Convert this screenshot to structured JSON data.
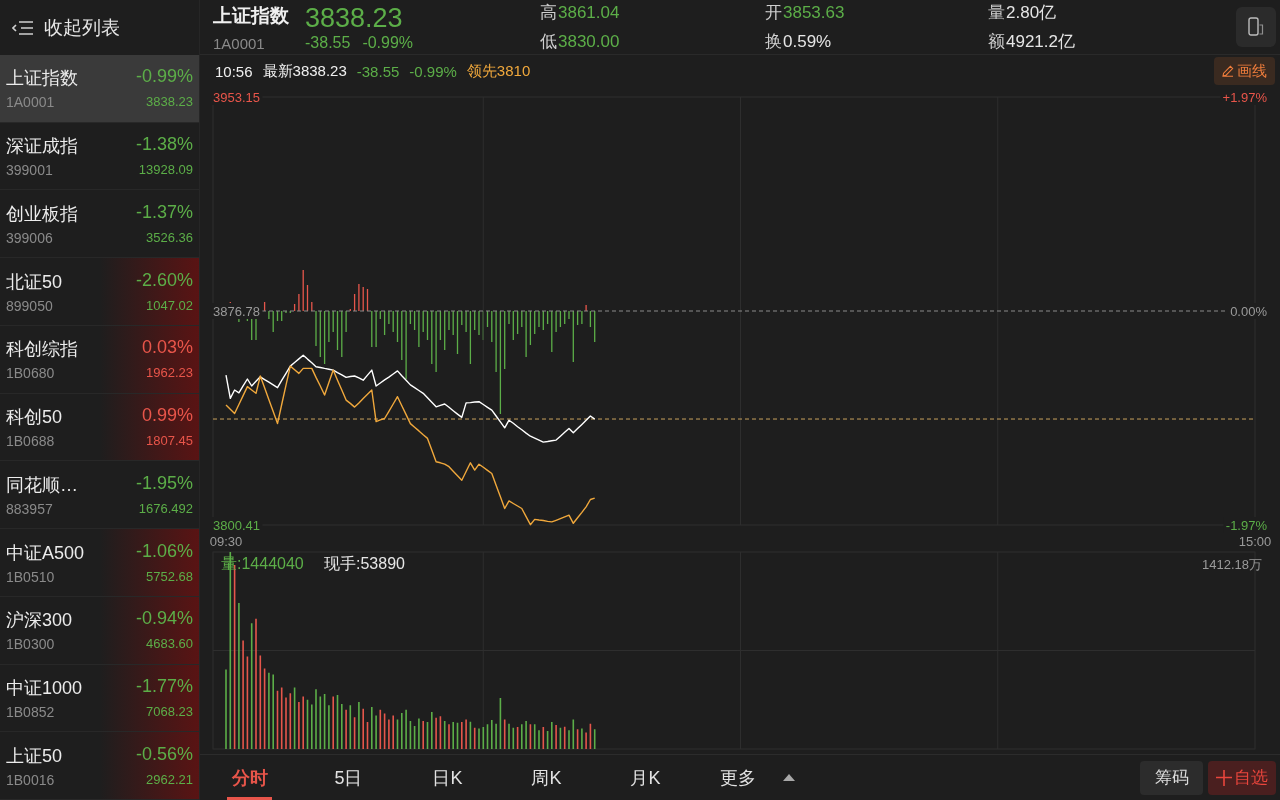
{
  "sidebar": {
    "header": {
      "label": "收起列表"
    },
    "items": [
      {
        "name": "上证指数",
        "code": "1A0001",
        "change": "-0.99%",
        "price": "3838.23",
        "rising": false,
        "selected": true,
        "flash": false
      },
      {
        "name": "深证成指",
        "code": "399001",
        "change": "-1.38%",
        "price": "13928.09",
        "rising": false,
        "selected": false,
        "flash": false
      },
      {
        "name": "创业板指",
        "code": "399006",
        "change": "-1.37%",
        "price": "3526.36",
        "rising": false,
        "selected": false,
        "flash": false
      },
      {
        "name": "北证50",
        "code": "899050",
        "change": "-2.60%",
        "price": "1047.02",
        "rising": false,
        "selected": false,
        "flash": true
      },
      {
        "name": "科创综指",
        "code": "1B0680",
        "change": "0.03%",
        "price": "1962.23",
        "rising": true,
        "selected": false,
        "flash": true
      },
      {
        "name": "科创50",
        "code": "1B0688",
        "change": "0.99%",
        "price": "1807.45",
        "rising": true,
        "selected": false,
        "flash": true
      },
      {
        "name": "同花顺…",
        "code": "883957",
        "change": "-1.95%",
        "price": "1676.492",
        "rising": false,
        "selected": false,
        "flash": false
      },
      {
        "name": "中证A500",
        "code": "1B0510",
        "change": "-1.06%",
        "price": "5752.68",
        "rising": false,
        "selected": false,
        "flash": true
      },
      {
        "name": "沪深300",
        "code": "1B0300",
        "change": "-0.94%",
        "price": "4683.60",
        "rising": false,
        "selected": false,
        "flash": true
      },
      {
        "name": "中证1000",
        "code": "1B0852",
        "change": "-1.77%",
        "price": "7068.23",
        "rising": false,
        "selected": false,
        "flash": true
      },
      {
        "name": "上证50",
        "code": "1B0016",
        "change": "-0.56%",
        "price": "2962.21",
        "rising": false,
        "selected": false,
        "flash": true
      }
    ]
  },
  "quote": {
    "name": "上证指数",
    "code": "1A0001",
    "price": "3838.23",
    "change": "-38.55",
    "change_pct": "-0.99%",
    "rising": false,
    "stats": [
      {
        "label": "高",
        "value": "3861.04",
        "falling": true
      },
      {
        "label": "低",
        "value": "3830.00",
        "falling": true
      },
      {
        "label": "开",
        "value": "3853.63",
        "falling": true
      },
      {
        "label": "换",
        "value": "0.59%",
        "falling": false
      },
      {
        "label": "量",
        "value": "2.80亿",
        "falling": false
      },
      {
        "label": "额",
        "value": "4921.2亿",
        "falling": false
      }
    ]
  },
  "chart": {
    "time": "10:56",
    "latest": "最新3838.23",
    "change": "-38.55",
    "change_pct": "-0.99%",
    "rising": false,
    "lead": "领先3810",
    "draw_button": {
      "label": "画线"
    },
    "volume": "量:1444040",
    "current": "现手:53890",
    "volume_scale": "1412.18万",
    "chart_data": {
      "type": "line",
      "categories": [
        "09:30",
        null,
        null,
        null,
        null,
        null,
        null,
        null,
        null,
        null,
        null,
        null,
        null,
        null,
        null,
        null,
        null,
        null,
        null,
        null,
        null,
        null,
        null,
        null,
        null,
        null,
        null,
        null,
        null,
        null,
        null,
        null,
        null,
        null,
        null,
        null,
        null,
        null,
        null,
        null,
        null,
        null,
        null,
        null,
        null,
        null,
        null,
        null,
        null,
        null,
        null,
        null,
        null,
        null,
        null,
        null,
        null,
        null,
        null,
        null,
        null,
        null,
        null,
        null,
        null,
        null,
        null,
        null,
        null,
        null,
        null,
        null,
        null,
        null,
        null,
        null,
        null,
        null,
        null,
        null,
        null,
        null,
        null,
        null,
        null,
        null,
        null,
        null,
        null,
        null,
        null,
        null,
        null,
        null,
        null,
        null,
        null,
        null,
        null,
        null,
        null,
        null,
        null,
        null,
        null,
        null,
        null,
        null,
        null,
        null,
        null,
        null,
        null,
        null,
        null,
        null,
        null,
        null,
        null,
        null,
        null,
        null,
        null,
        null,
        null,
        null,
        null,
        null,
        null,
        null,
        null,
        null,
        null,
        null,
        null,
        null,
        null,
        null,
        null,
        null,
        null,
        null,
        null,
        null,
        null,
        null,
        null,
        null,
        null,
        null,
        null,
        null,
        null,
        null,
        null,
        null,
        null,
        null,
        null,
        null,
        null,
        null,
        null,
        null,
        null,
        null,
        null,
        null,
        null,
        null,
        null,
        null,
        null,
        null,
        null,
        null,
        null,
        null,
        null,
        null,
        null,
        null,
        null,
        null,
        null,
        null,
        null,
        null,
        null,
        null,
        null,
        null,
        null,
        null,
        null,
        null,
        null,
        null,
        null,
        null,
        null,
        null,
        null,
        null,
        null,
        null,
        null,
        null,
        null,
        null,
        null,
        null,
        null,
        null,
        null,
        null,
        null,
        null,
        null,
        null,
        null,
        null,
        null,
        null,
        null,
        null,
        null,
        null,
        null,
        null,
        null,
        null,
        null,
        null,
        null,
        null,
        null,
        null,
        null,
        null,
        "15:00"
      ],
      "ylim": [
        3800.41,
        3953.15
      ],
      "y2lim": [
        -1.97,
        1.97
      ],
      "yticks": [
        3953.15,
        3876.78,
        3800.41
      ],
      "y2ticks": [
        {
          "value": 1.97,
          "label": "+1.97%"
        },
        {
          "value": 0,
          "label": "0.00%"
        },
        {
          "value": -1.97,
          "label": "-1.97%"
        }
      ],
      "grid": "x",
      "ref_lines": [
        {
          "axis": "y",
          "value": 3876.78,
          "color": "#8a8a8a",
          "line_style": "dashed"
        },
        {
          "axis": "y",
          "value": 3838.23,
          "color": "#c9a25e",
          "line_style": "dashed"
        }
      ],
      "series": [
        {
          "color": "#ffffff",
          "values": [
            3853.9,
            3845.6,
            3848.6,
            3847.6,
            3850.1,
            3852.5,
            3850.0,
            3851.7,
            3853.3,
            3852.3,
            3851.4,
            3850.4,
            3849.4,
            3852.0,
            3854.5,
            3857.1,
            3858.4,
            3859.7,
            3861.0,
            3859.6,
            3858.3,
            3856.9,
            3856.6,
            3856.3,
            3856.0,
            3855.7,
            3854.8,
            3854.0,
            3853.1,
            3853.4,
            3853.6,
            3852.9,
            3852.1,
            3853.9,
            3855.7,
            3850.0,
            3851.1,
            3852.2,
            3853.2,
            3854.3,
            3855.4,
            3853.7,
            3852.1,
            3850.4,
            3849.4,
            3848.4,
            3847.4,
            3845.8,
            3844.2,
            3842.6,
            3843.1,
            3843.6,
            3842.4,
            3841.2,
            3840.0,
            3838.8,
            3844.0,
            3844.1,
            3844.3,
            3844.4,
            3843.4,
            3842.4,
            3841.4,
            3839.3,
            3837.2,
            3835.1,
            3837.8,
            3836.7,
            3835.5,
            3834.4,
            3833.2,
            3832.1,
            3831.4,
            3830.7,
            3830.0,
            3830.2,
            3830.5,
            3830.7,
            3832.1,
            3833.5,
            3834.9,
            3833.3,
            3834.8,
            3836.3,
            3837.8,
            3839.3,
            3838.2,
            null,
            null,
            null,
            null,
            null,
            null,
            null,
            null,
            null,
            null,
            null,
            null,
            null,
            null,
            null,
            null,
            null,
            null,
            null,
            null,
            null,
            null,
            null,
            null,
            null,
            null,
            null,
            null,
            null,
            null,
            null,
            null,
            null,
            null,
            null,
            null,
            null,
            null,
            null,
            null,
            null,
            null,
            null,
            null,
            null,
            null,
            null,
            null,
            null,
            null,
            null,
            null,
            null,
            null,
            null,
            null,
            null,
            null,
            null,
            null,
            null,
            null,
            null,
            null,
            null,
            null,
            null,
            null,
            null,
            null,
            null,
            null,
            null,
            null,
            null,
            null,
            null,
            null,
            null,
            null,
            null,
            null,
            null,
            null,
            null,
            null,
            null,
            null,
            null,
            null,
            null,
            null,
            null,
            null,
            null,
            null,
            null,
            null,
            null,
            null,
            null,
            null,
            null,
            null,
            null,
            null,
            null,
            null,
            null,
            null,
            null,
            null,
            null,
            null,
            null,
            null,
            null,
            null,
            null,
            null,
            null,
            null,
            null,
            null,
            null,
            null,
            null,
            null,
            null,
            null,
            null,
            null,
            null,
            null,
            null,
            null,
            null,
            null,
            null,
            null,
            null,
            null,
            null,
            null,
            null,
            null,
            null,
            null,
            null,
            null,
            null,
            null,
            null,
            null
          ]
        },
        {
          "color": "#f0a83c",
          "values": [
            3843.2,
            3841.7,
            3840.2,
            3843.4,
            3846.6,
            3849.8,
            3848.6,
            3847.4,
            3853.6,
            3849.4,
            3845.1,
            3840.9,
            3836.6,
            3843.4,
            3850.3,
            3857.1,
            3855.8,
            3854.5,
            3856.3,
            3856.3,
            3856.3,
            3853.1,
            3850.0,
            3846.8,
            3851.3,
            3855.7,
            3852.1,
            3848.6,
            3845.0,
            3843.8,
            3842.5,
            3844.0,
            3845.6,
            3847.1,
            3848.6,
            3837.3,
            3837.9,
            3838.4,
            3841.0,
            3843.6,
            3846.2,
            3843.0,
            3839.8,
            3836.6,
            3835.3,
            3834.0,
            3832.6,
            3831.3,
            3827.2,
            3823.0,
            3822.6,
            3822.1,
            3821.2,
            3819.6,
            3818.0,
            3816.4,
            3819.5,
            3822.6,
            3820.0,
            3822.1,
            3821.0,
            3819.9,
            3818.8,
            3814.6,
            3810.5,
            3806.3,
            3809.0,
            3808.1,
            3807.2,
            3806.3,
            3803.4,
            3800.5,
            3802.4,
            3802.2,
            3802.0,
            3801.7,
            3801.5,
            3802.1,
            3802.7,
            3803.3,
            3803.9,
            3801.0,
            3803.0,
            3804.9,
            3806.9,
            3809.5,
            3810.0,
            null,
            null,
            null,
            null,
            null,
            null,
            null,
            null,
            null,
            null,
            null,
            null,
            null,
            null,
            null,
            null,
            null,
            null,
            null,
            null,
            null,
            null,
            null,
            null,
            null,
            null,
            null,
            null,
            null,
            null,
            null,
            null,
            null,
            null,
            null,
            null,
            null,
            null,
            null,
            null,
            null,
            null,
            null,
            null,
            null,
            null,
            null,
            null,
            null,
            null,
            null,
            null,
            null,
            null,
            null,
            null,
            null,
            null,
            null,
            null,
            null,
            null,
            null,
            null,
            null,
            null,
            null,
            null,
            null,
            null,
            null,
            null,
            null,
            null,
            null,
            null,
            null,
            null,
            null,
            null,
            null,
            null,
            null,
            null,
            null,
            null,
            null,
            null,
            null,
            null,
            null,
            null,
            null,
            null,
            null,
            null,
            null,
            null,
            null,
            null,
            null,
            null,
            null,
            null,
            null,
            null,
            null,
            null,
            null,
            null,
            null,
            null,
            null,
            null,
            null,
            null,
            null,
            null,
            null,
            null,
            null,
            null,
            null,
            null,
            null,
            null,
            null,
            null,
            null,
            null,
            null,
            null,
            null,
            null,
            null,
            null,
            null,
            null,
            null,
            null,
            null,
            null,
            null,
            null,
            null,
            null,
            null,
            null,
            null,
            null,
            null,
            null,
            null,
            null
          ]
        }
      ]
    }
  },
  "tabs": [
    {
      "label": "分时",
      "selected": true,
      "kind": "period"
    },
    {
      "label": "5日",
      "selected": false,
      "kind": "period"
    },
    {
      "label": "日K",
      "selected": false,
      "kind": "period"
    },
    {
      "label": "周K",
      "selected": false,
      "kind": "period"
    },
    {
      "label": "月K",
      "selected": false,
      "kind": "period"
    },
    {
      "label": "更多",
      "selected": false,
      "kind": "menu"
    }
  ],
  "buttons": [
    {
      "label": "筹码",
      "kind": "plain"
    },
    {
      "label": "自选",
      "kind": "add"
    }
  ]
}
